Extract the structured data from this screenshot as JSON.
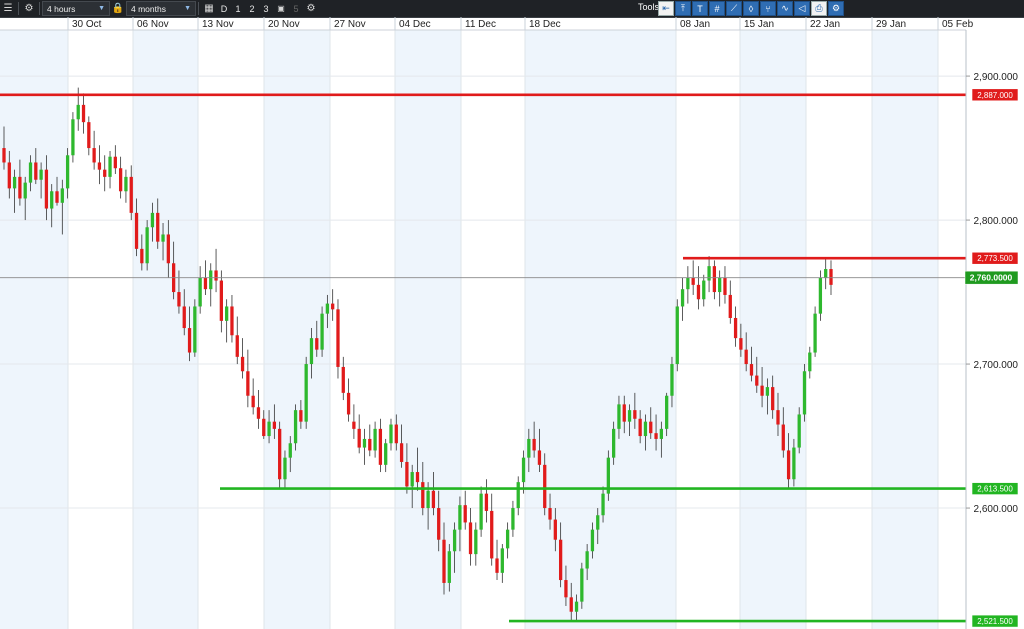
{
  "toolbar": {
    "interval": "4 hours",
    "range": "4 months",
    "period_buttons": [
      "D",
      "1",
      "2",
      "3"
    ],
    "disabled_button": "5",
    "tools_label": "Tools",
    "icons": [
      "menu-icon",
      "gear-icon",
      "lock-icon",
      "calendar-icon",
      "chart-type-icon",
      "settings-icon",
      "back-arrow-icon",
      "cursor-icon",
      "text-icon",
      "grid-icon",
      "trendline-icon",
      "fib-icon",
      "fork-icon",
      "wave-icon",
      "shape-icon",
      "print-icon",
      "config-icon"
    ]
  },
  "chart_data": {
    "type": "candlestick",
    "title": "",
    "x_tick_labels": [
      "30 Oct",
      "06 Nov",
      "13 Nov",
      "20 Nov",
      "27 Nov",
      "04 Dec",
      "11 Dec",
      "18 Dec",
      "08 Jan",
      "15 Jan",
      "22 Jan",
      "29 Jan",
      "05 Feb"
    ],
    "y_tick_labels": [
      "2,900.000",
      "2,800.000",
      "2,700.000",
      "2,600.000"
    ],
    "y_ticks": [
      2900,
      2800,
      2700,
      2600
    ],
    "ylim": [
      2516,
      2932
    ],
    "current_price": 2760,
    "current_price_label": "2,760.0000",
    "up_color": "#2eb82e",
    "down_color": "#e11b1b",
    "levels": [
      {
        "label": "2,887.000",
        "value": 2887,
        "color": "#e01b1b",
        "start": "full"
      },
      {
        "label": "2,773.500",
        "value": 2773.5,
        "color": "#e01b1b",
        "start": "12 Jan"
      },
      {
        "label": "2,613.500",
        "value": 2613.5,
        "color": "#22b522",
        "start": "10 Nov"
      },
      {
        "label": "2,521.500",
        "value": 2521.5,
        "color": "#22b522",
        "start": "14 Dec"
      }
    ],
    "candles": [
      [
        2850,
        2865,
        2835,
        2840
      ],
      [
        2840,
        2848,
        2815,
        2822
      ],
      [
        2822,
        2835,
        2805,
        2830
      ],
      [
        2830,
        2842,
        2810,
        2815
      ],
      [
        2815,
        2830,
        2800,
        2826
      ],
      [
        2826,
        2845,
        2820,
        2840
      ],
      [
        2840,
        2850,
        2825,
        2828
      ],
      [
        2828,
        2840,
        2815,
        2835
      ],
      [
        2835,
        2845,
        2800,
        2808
      ],
      [
        2808,
        2825,
        2795,
        2820
      ],
      [
        2820,
        2830,
        2810,
        2812
      ],
      [
        2812,
        2828,
        2790,
        2822
      ],
      [
        2822,
        2850,
        2815,
        2845
      ],
      [
        2845,
        2875,
        2840,
        2870
      ],
      [
        2870,
        2892,
        2862,
        2880
      ],
      [
        2880,
        2888,
        2860,
        2868
      ],
      [
        2868,
        2872,
        2845,
        2850
      ],
      [
        2850,
        2862,
        2835,
        2840
      ],
      [
        2840,
        2852,
        2825,
        2835
      ],
      [
        2835,
        2845,
        2820,
        2830
      ],
      [
        2830,
        2848,
        2822,
        2844
      ],
      [
        2844,
        2852,
        2832,
        2836
      ],
      [
        2836,
        2844,
        2815,
        2820
      ],
      [
        2820,
        2835,
        2812,
        2830
      ],
      [
        2830,
        2838,
        2800,
        2805
      ],
      [
        2805,
        2815,
        2775,
        2780
      ],
      [
        2780,
        2790,
        2765,
        2770
      ],
      [
        2770,
        2800,
        2765,
        2795
      ],
      [
        2795,
        2812,
        2785,
        2805
      ],
      [
        2805,
        2815,
        2780,
        2785
      ],
      [
        2785,
        2798,
        2772,
        2790
      ],
      [
        2790,
        2800,
        2760,
        2770
      ],
      [
        2770,
        2785,
        2745,
        2750
      ],
      [
        2750,
        2765,
        2735,
        2740
      ],
      [
        2740,
        2752,
        2720,
        2725
      ],
      [
        2725,
        2740,
        2702,
        2708
      ],
      [
        2708,
        2745,
        2705,
        2740
      ],
      [
        2740,
        2768,
        2735,
        2760
      ],
      [
        2760,
        2772,
        2748,
        2752
      ],
      [
        2752,
        2770,
        2740,
        2765
      ],
      [
        2765,
        2780,
        2750,
        2758
      ],
      [
        2758,
        2765,
        2722,
        2730
      ],
      [
        2730,
        2745,
        2715,
        2740
      ],
      [
        2740,
        2748,
        2715,
        2720
      ],
      [
        2720,
        2733,
        2700,
        2705
      ],
      [
        2705,
        2718,
        2690,
        2695
      ],
      [
        2695,
        2710,
        2670,
        2678
      ],
      [
        2678,
        2690,
        2665,
        2670
      ],
      [
        2670,
        2682,
        2655,
        2662
      ],
      [
        2662,
        2668,
        2648,
        2650
      ],
      [
        2650,
        2668,
        2645,
        2660
      ],
      [
        2660,
        2672,
        2648,
        2655
      ],
      [
        2655,
        2660,
        2613,
        2620
      ],
      [
        2620,
        2640,
        2614,
        2635
      ],
      [
        2635,
        2650,
        2625,
        2645
      ],
      [
        2645,
        2672,
        2640,
        2668
      ],
      [
        2668,
        2675,
        2655,
        2660
      ],
      [
        2660,
        2705,
        2655,
        2700
      ],
      [
        2700,
        2725,
        2690,
        2718
      ],
      [
        2718,
        2730,
        2705,
        2710
      ],
      [
        2710,
        2740,
        2705,
        2735
      ],
      [
        2735,
        2748,
        2725,
        2742
      ],
      [
        2742,
        2752,
        2730,
        2738
      ],
      [
        2738,
        2745,
        2690,
        2698
      ],
      [
        2698,
        2705,
        2675,
        2680
      ],
      [
        2680,
        2690,
        2660,
        2665
      ],
      [
        2660,
        2672,
        2648,
        2655
      ],
      [
        2655,
        2665,
        2638,
        2642
      ],
      [
        2642,
        2655,
        2630,
        2648
      ],
      [
        2648,
        2658,
        2636,
        2640
      ],
      [
        2640,
        2660,
        2635,
        2655
      ],
      [
        2655,
        2662,
        2625,
        2630
      ],
      [
        2630,
        2648,
        2625,
        2645
      ],
      [
        2645,
        2662,
        2640,
        2658
      ],
      [
        2658,
        2665,
        2640,
        2645
      ],
      [
        2645,
        2658,
        2628,
        2632
      ],
      [
        2632,
        2645,
        2610,
        2615
      ],
      [
        2615,
        2630,
        2600,
        2625
      ],
      [
        2625,
        2642,
        2612,
        2618
      ],
      [
        2618,
        2632,
        2595,
        2600
      ],
      [
        2600,
        2618,
        2585,
        2612
      ],
      [
        2612,
        2625,
        2595,
        2600
      ],
      [
        2600,
        2612,
        2570,
        2578
      ],
      [
        2578,
        2590,
        2540,
        2548
      ],
      [
        2548,
        2575,
        2542,
        2570
      ],
      [
        2570,
        2590,
        2555,
        2585
      ],
      [
        2585,
        2608,
        2570,
        2602
      ],
      [
        2602,
        2612,
        2585,
        2590
      ],
      [
        2590,
        2600,
        2560,
        2568
      ],
      [
        2568,
        2590,
        2560,
        2585
      ],
      [
        2585,
        2615,
        2580,
        2610
      ],
      [
        2610,
        2620,
        2590,
        2598
      ],
      [
        2598,
        2610,
        2560,
        2565
      ],
      [
        2565,
        2578,
        2550,
        2555
      ],
      [
        2555,
        2575,
        2548,
        2572
      ],
      [
        2572,
        2590,
        2565,
        2585
      ],
      [
        2585,
        2605,
        2580,
        2600
      ],
      [
        2600,
        2622,
        2595,
        2618
      ],
      [
        2618,
        2640,
        2610,
        2635
      ],
      [
        2635,
        2655,
        2625,
        2648
      ],
      [
        2648,
        2660,
        2635,
        2640
      ],
      [
        2640,
        2655,
        2625,
        2630
      ],
      [
        2630,
        2638,
        2595,
        2600
      ],
      [
        2600,
        2610,
        2585,
        2592
      ],
      [
        2592,
        2600,
        2570,
        2578
      ],
      [
        2578,
        2590,
        2545,
        2550
      ],
      [
        2550,
        2560,
        2532,
        2538
      ],
      [
        2538,
        2548,
        2522,
        2528
      ],
      [
        2528,
        2540,
        2521,
        2535
      ],
      [
        2535,
        2562,
        2530,
        2558
      ],
      [
        2558,
        2575,
        2550,
        2570
      ],
      [
        2570,
        2590,
        2565,
        2585
      ],
      [
        2585,
        2600,
        2575,
        2595
      ],
      [
        2595,
        2615,
        2590,
        2610
      ],
      [
        2610,
        2640,
        2605,
        2635
      ],
      [
        2635,
        2660,
        2630,
        2655
      ],
      [
        2655,
        2678,
        2648,
        2672
      ],
      [
        2672,
        2678,
        2652,
        2660
      ],
      [
        2660,
        2672,
        2650,
        2668
      ],
      [
        2668,
        2680,
        2655,
        2662
      ],
      [
        2662,
        2668,
        2645,
        2650
      ],
      [
        2650,
        2665,
        2640,
        2660
      ],
      [
        2660,
        2670,
        2648,
        2652
      ],
      [
        2652,
        2665,
        2640,
        2648
      ],
      [
        2648,
        2660,
        2635,
        2655
      ],
      [
        2655,
        2680,
        2650,
        2678
      ],
      [
        2678,
        2705,
        2670,
        2700
      ],
      [
        2700,
        2745,
        2695,
        2740
      ],
      [
        2740,
        2760,
        2730,
        2752
      ],
      [
        2752,
        2768,
        2742,
        2760
      ],
      [
        2760,
        2772,
        2748,
        2755
      ],
      [
        2755,
        2768,
        2738,
        2745
      ],
      [
        2745,
        2762,
        2740,
        2758
      ],
      [
        2758,
        2775,
        2750,
        2768
      ],
      [
        2768,
        2772,
        2745,
        2750
      ],
      [
        2750,
        2765,
        2740,
        2760
      ],
      [
        2760,
        2768,
        2742,
        2748
      ],
      [
        2748,
        2758,
        2728,
        2732
      ],
      [
        2732,
        2740,
        2712,
        2718
      ],
      [
        2718,
        2728,
        2705,
        2710
      ],
      [
        2710,
        2722,
        2695,
        2700
      ],
      [
        2700,
        2712,
        2688,
        2692
      ],
      [
        2692,
        2705,
        2680,
        2685
      ],
      [
        2685,
        2698,
        2670,
        2678
      ],
      [
        2678,
        2690,
        2665,
        2684
      ],
      [
        2684,
        2692,
        2662,
        2668
      ],
      [
        2668,
        2680,
        2650,
        2658
      ],
      [
        2658,
        2670,
        2635,
        2640
      ],
      [
        2640,
        2652,
        2613,
        2620
      ],
      [
        2620,
        2648,
        2615,
        2642
      ],
      [
        2642,
        2670,
        2638,
        2665
      ],
      [
        2665,
        2700,
        2660,
        2695
      ],
      [
        2695,
        2712,
        2690,
        2708
      ],
      [
        2708,
        2740,
        2705,
        2735
      ],
      [
        2735,
        2765,
        2730,
        2760
      ],
      [
        2760,
        2773,
        2752,
        2766
      ],
      [
        2766,
        2772,
        2748,
        2755
      ]
    ]
  }
}
